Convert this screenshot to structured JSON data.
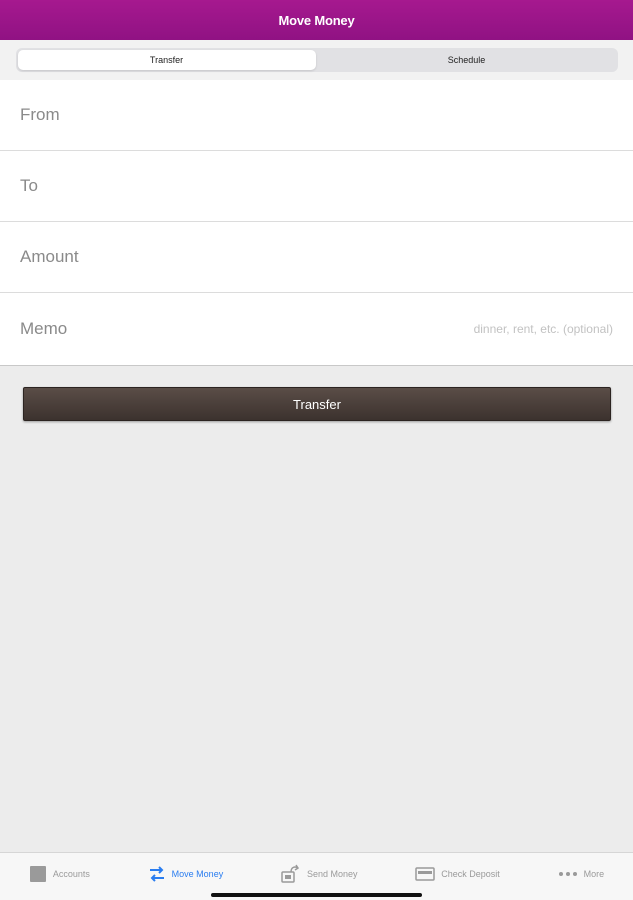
{
  "header": {
    "title": "Move Money"
  },
  "segment": {
    "tabs": [
      {
        "label": "Transfer"
      },
      {
        "label": "Schedule"
      }
    ]
  },
  "form": {
    "from_label": "From",
    "to_label": "To",
    "amount_label": "Amount",
    "memo_label": "Memo",
    "memo_placeholder": "dinner, rent, etc. (optional)"
  },
  "action": {
    "transfer_label": "Transfer"
  },
  "tabbar": {
    "items": [
      {
        "label": "Accounts",
        "icon": "accounts-icon"
      },
      {
        "label": "Move Money",
        "icon": "transfer-arrows-icon"
      },
      {
        "label": "Send Money",
        "icon": "send-money-icon"
      },
      {
        "label": "Check Deposit",
        "icon": "check-deposit-icon"
      },
      {
        "label": "More",
        "icon": "more-dots-icon"
      }
    ]
  },
  "colors": {
    "header": "#9c1489",
    "button": "#4a3f3a",
    "active_tab": "#2a7df0"
  }
}
